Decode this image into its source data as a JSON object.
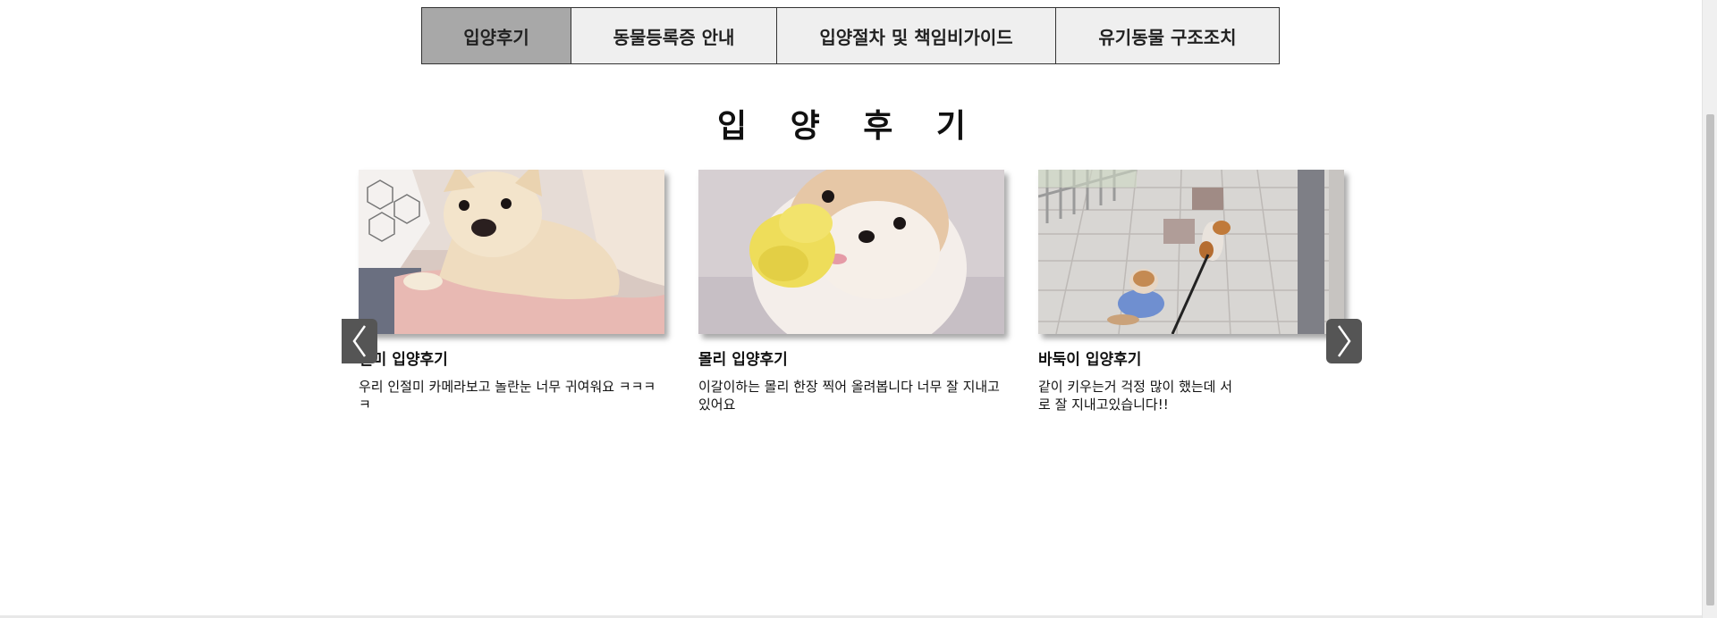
{
  "tabs": [
    {
      "label": "입양후기",
      "active": true
    },
    {
      "label": "동물등록증 안내",
      "active": false
    },
    {
      "label": "입양절차 및 책임비가이드",
      "active": false
    },
    {
      "label": "유기동물 구조조치",
      "active": false
    }
  ],
  "section": {
    "title": "입 양 후 기"
  },
  "carousel": {
    "prev_icon": "chevron-left-icon",
    "next_icon": "chevron-right-icon",
    "cards": [
      {
        "title": "절미 입양후기",
        "description": "우리 인절미 카메라보고 놀란눈 너무 귀여워요 ㅋㅋㅋㅋ",
        "image": "puppy-photo-chihuahua"
      },
      {
        "title": "몰리 입양후기",
        "description": "이갈이하는 몰리 한장 찍어 올려봅니다 너무 잘 지내고 있어요",
        "image": "puppy-photo-pomeranian"
      },
      {
        "title": "바둑이 입양후기",
        "description": "같이 키우는거 걱정 많이 했는데 서로 잘 지내고있습니다!!",
        "image": "dogs-walking-photo"
      }
    ]
  },
  "colors": {
    "active_tab": "#a8a8a8",
    "tab_bg": "#efefef",
    "arrow_bg": "#555555"
  }
}
